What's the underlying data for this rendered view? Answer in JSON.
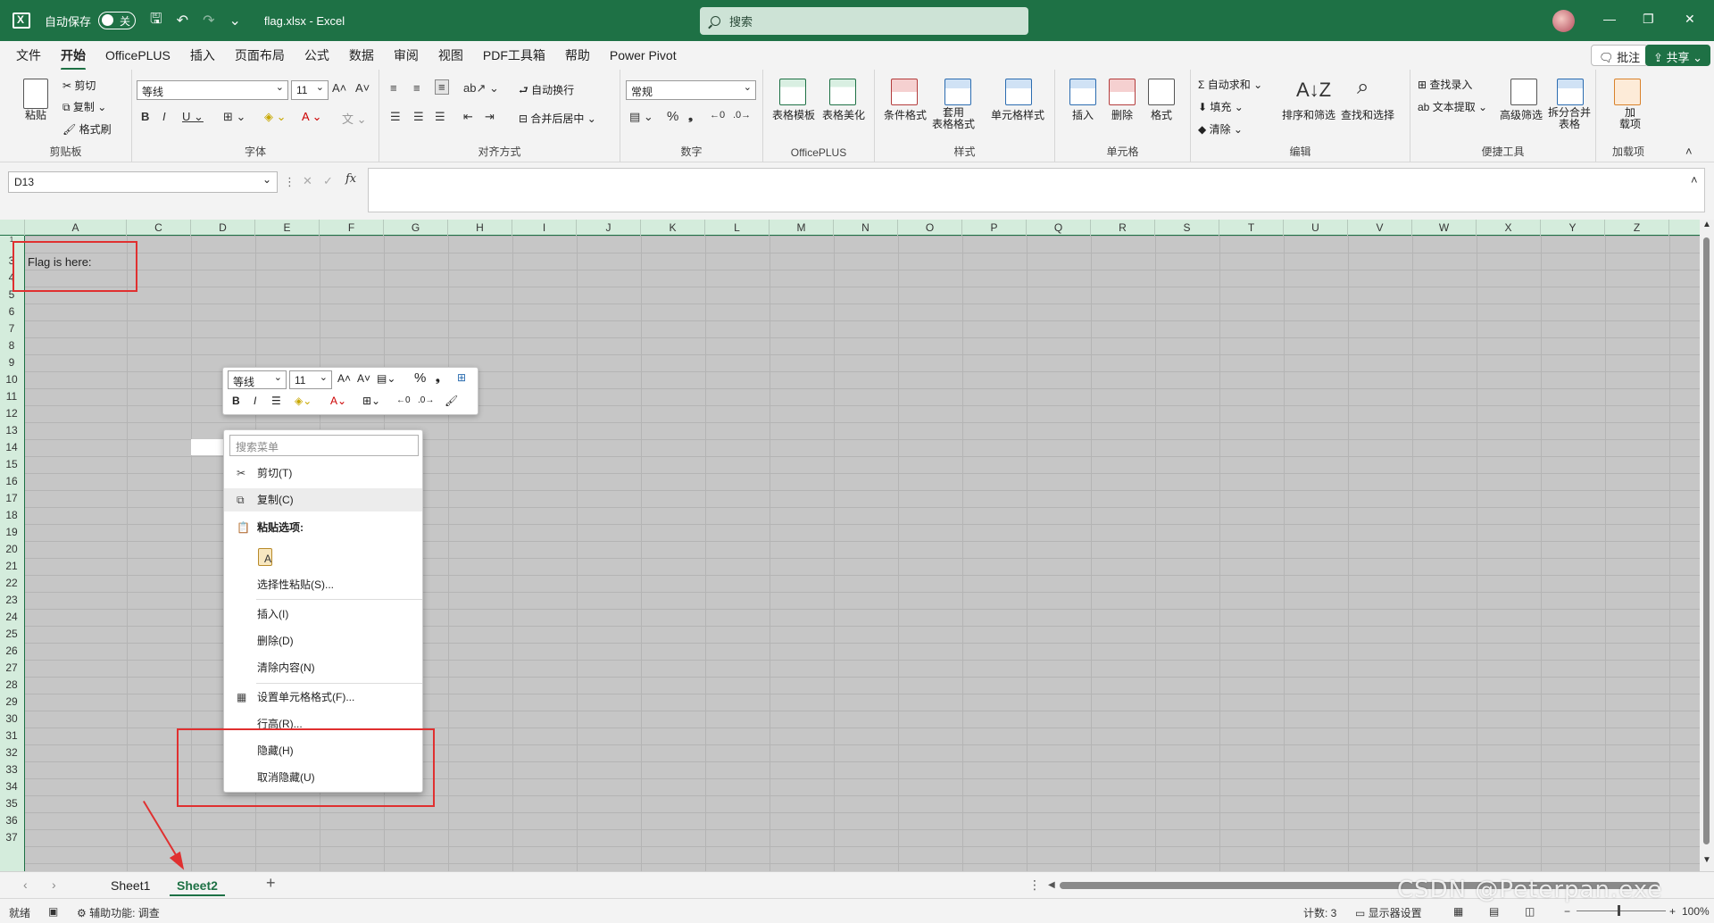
{
  "titlebar": {
    "autosave_label": "自动保存",
    "autosave_state": "关",
    "filename": "flag.xlsx  -  Excel",
    "search_placeholder": "搜索"
  },
  "menu": {
    "tabs": [
      "文件",
      "开始",
      "OfficePLUS",
      "插入",
      "页面布局",
      "公式",
      "数据",
      "审阅",
      "视图",
      "PDF工具箱",
      "帮助",
      "Power Pivot"
    ],
    "active_tab": "开始",
    "comment_btn": "批注",
    "share_btn": "共享"
  },
  "ribbon": {
    "clipboard": {
      "paste": "粘贴",
      "cut": "剪切",
      "copy": "复制",
      "format_painter": "格式刷",
      "label": "剪贴板"
    },
    "font": {
      "font_name": "等线",
      "font_size": "11",
      "label": "字体"
    },
    "alignment": {
      "wrap": "自动换行",
      "merge": "合并后居中",
      "label": "对齐方式"
    },
    "number": {
      "format": "常规",
      "label": "数字"
    },
    "officeplus": {
      "template": "表格模板",
      "beautify": "表格美化",
      "label": "OfficePLUS"
    },
    "styles": {
      "conditional": "条件格式",
      "table_format": "套用\n表格格式",
      "cell_styles": "单元格样式",
      "label": "样式"
    },
    "cells": {
      "insert": "插入",
      "delete": "删除",
      "format": "格式",
      "label": "单元格"
    },
    "editing": {
      "autosum": "自动求和",
      "fill": "填充",
      "clear": "清除",
      "sort": "排序和筛选",
      "find": "查找和选择",
      "label": "编辑"
    },
    "tools": {
      "lookup": "查找录入",
      "extract": "文本提取",
      "advfilter": "高级筛选",
      "split": "拆分合并\n表格",
      "label": "便捷工具"
    },
    "addins": {
      "addin": "加\n载项",
      "label": "加载项"
    }
  },
  "formula_bar": {
    "name_box": "D13",
    "fx": "fx",
    "content": ""
  },
  "grid": {
    "columns": [
      "A",
      "C",
      "D",
      "E",
      "F",
      "G",
      "H",
      "I",
      "J",
      "K",
      "L",
      "M",
      "N",
      "O",
      "P",
      "Q",
      "R",
      "S",
      "T",
      "U",
      "V",
      "W",
      "X",
      "Y",
      "Z"
    ],
    "rows": [
      "1",
      "3",
      "4",
      "5",
      "6",
      "7",
      "8",
      "9",
      "10",
      "11",
      "12",
      "13",
      "14",
      "15",
      "16",
      "17",
      "18",
      "19",
      "20",
      "21",
      "22",
      "23",
      "24",
      "25",
      "26",
      "27",
      "28",
      "29",
      "30",
      "31",
      "32",
      "33",
      "34",
      "35",
      "36",
      "37"
    ],
    "a_cell_text": "Flag is here:"
  },
  "mini_toolbar": {
    "font": "等线",
    "size": "11"
  },
  "context_menu": {
    "search_placeholder": "搜索菜单",
    "items": {
      "cut": "剪切(T)",
      "copy": "复制(C)",
      "paste_options": "粘贴选项:",
      "paste_special": "选择性粘贴(S)...",
      "insert": "插入(I)",
      "delete": "删除(D)",
      "clear": "清除内容(N)",
      "format_cells": "设置单元格格式(F)...",
      "row_height": "行高(R)...",
      "hide": "隐藏(H)",
      "unhide": "取消隐藏(U)"
    }
  },
  "sheets": {
    "tabs": [
      "Sheet1",
      "Sheet2"
    ],
    "active": "Sheet2"
  },
  "status": {
    "ready": "就绪",
    "accessibility": "辅助功能: 调查",
    "count": "计数: 3",
    "display": "显示器设置",
    "zoom": "100%"
  },
  "watermark": "CSDN @Peterpan.exe",
  "colors": {
    "excel_green": "#1e7145",
    "annotation_red": "#e03030"
  }
}
